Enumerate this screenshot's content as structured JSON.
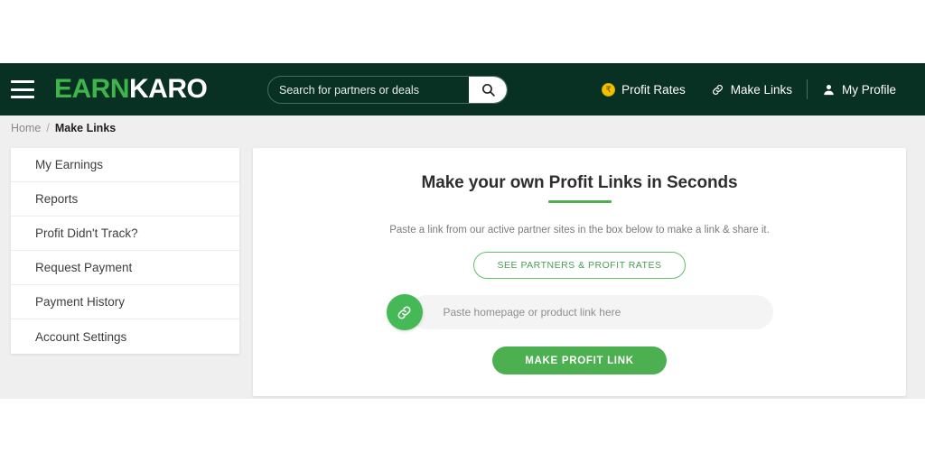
{
  "header": {
    "menu_icon": "hamburger-icon",
    "logo_part1": "EARN",
    "logo_part2": "KARO",
    "search": {
      "placeholder": "Search for partners or deals",
      "value": "",
      "button_icon": "search-icon"
    },
    "nav": [
      {
        "label": "Profit Rates",
        "icon": "coin-rupee-icon",
        "glyph": "₹"
      },
      {
        "label": "Make Links",
        "icon": "link-icon"
      },
      {
        "label": "My Profile",
        "icon": "user-icon"
      }
    ],
    "colors": {
      "bar": "#093123",
      "logo_accent": "#3db54a",
      "coin": "#f2c200"
    }
  },
  "breadcrumb": {
    "home": "Home",
    "separator": "/",
    "current": "Make Links"
  },
  "sidebar": {
    "items": [
      {
        "label": "My Earnings"
      },
      {
        "label": "Reports"
      },
      {
        "label": "Profit Didn't Track?"
      },
      {
        "label": "Request Payment"
      },
      {
        "label": "Payment History"
      },
      {
        "label": "Account Settings"
      }
    ]
  },
  "main": {
    "title": "Make your own Profit Links in Seconds",
    "subtitle": "Paste a link from our active partner sites in the box below to make a link & share it.",
    "partners_button": "SEE PARTNERS & PROFIT RATES",
    "link_input": {
      "placeholder": "Paste homepage or product link here",
      "value": "",
      "icon": "link-icon"
    },
    "cta_button": "MAKE PROFIT LINK",
    "colors": {
      "accent_green": "#4caf50",
      "badge_green": "#45b955",
      "outline_green": "#62bd6e"
    }
  }
}
